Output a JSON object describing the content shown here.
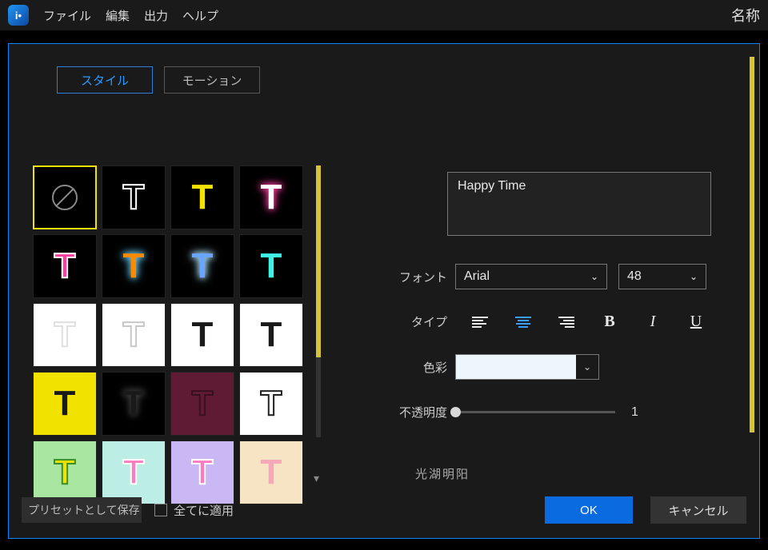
{
  "menubar": {
    "items": [
      "ファイル",
      "編集",
      "出力",
      "ヘルプ"
    ],
    "title_right": "名称"
  },
  "tabs": {
    "style": "スタイル",
    "motion": "モーション"
  },
  "text_value": "Happy Time",
  "labels": {
    "font": "フォント",
    "type": "タイプ",
    "color": "色彩",
    "opacity": "不透明度",
    "cutoff": "光湖明阳"
  },
  "font": {
    "family": "Arial",
    "size": "48"
  },
  "opacity": {
    "value": "1"
  },
  "buttons": {
    "preset": "プリセットとして保存",
    "apply_all": "全てに適用",
    "ok": "OK",
    "cancel": "キャンセル"
  },
  "color_value": "#edf6fb",
  "swatches": [
    {
      "bg": "#000",
      "t": "none"
    },
    {
      "bg": "#000",
      "fill": "transparent",
      "stroke": "#fff"
    },
    {
      "bg": "#000",
      "fill": "#f2e200"
    },
    {
      "bg": "#000",
      "fill": "#fff",
      "glow": "#ff3ea0"
    },
    {
      "bg": "#000",
      "fill": "#ff3ea0",
      "stroke": "#fff"
    },
    {
      "bg": "#000",
      "fill": "#ff8a00",
      "glow": "#6fd3ff"
    },
    {
      "bg": "#000",
      "fill": "#6aa6ff",
      "glow": "#b0e5ff"
    },
    {
      "bg": "#000",
      "fill": "#3ff0e6"
    },
    {
      "bg": "#fff",
      "fill": "#fff",
      "stroke": "#e0e0e0"
    },
    {
      "bg": "#fff",
      "fill": "#fff",
      "stroke": "#c8c8c8"
    },
    {
      "bg": "#fff",
      "fill": "#1a1a1a"
    },
    {
      "bg": "#fff",
      "fill": "#1a1a1a"
    },
    {
      "bg": "#f2e200",
      "fill": "#1a1a1a"
    },
    {
      "bg": "#000",
      "fill": "#1a1a1a",
      "glow": "#444"
    },
    {
      "bg": "#5e1b33",
      "fill": "#5e1b33",
      "stroke": "#3a0f20"
    },
    {
      "bg": "#fff",
      "fill": "transparent",
      "stroke": "#222"
    },
    {
      "bg": "#a8e6a1",
      "fill": "#f2e200",
      "stroke": "#3a8f2a"
    },
    {
      "bg": "#bdeee6",
      "fill": "#ff7abf",
      "stroke": "#fff"
    },
    {
      "bg": "#c9b8f3",
      "fill": "#ff7abf",
      "stroke": "#fff"
    },
    {
      "bg": "#f7e4c4",
      "fill": "#f5a8b8"
    }
  ]
}
